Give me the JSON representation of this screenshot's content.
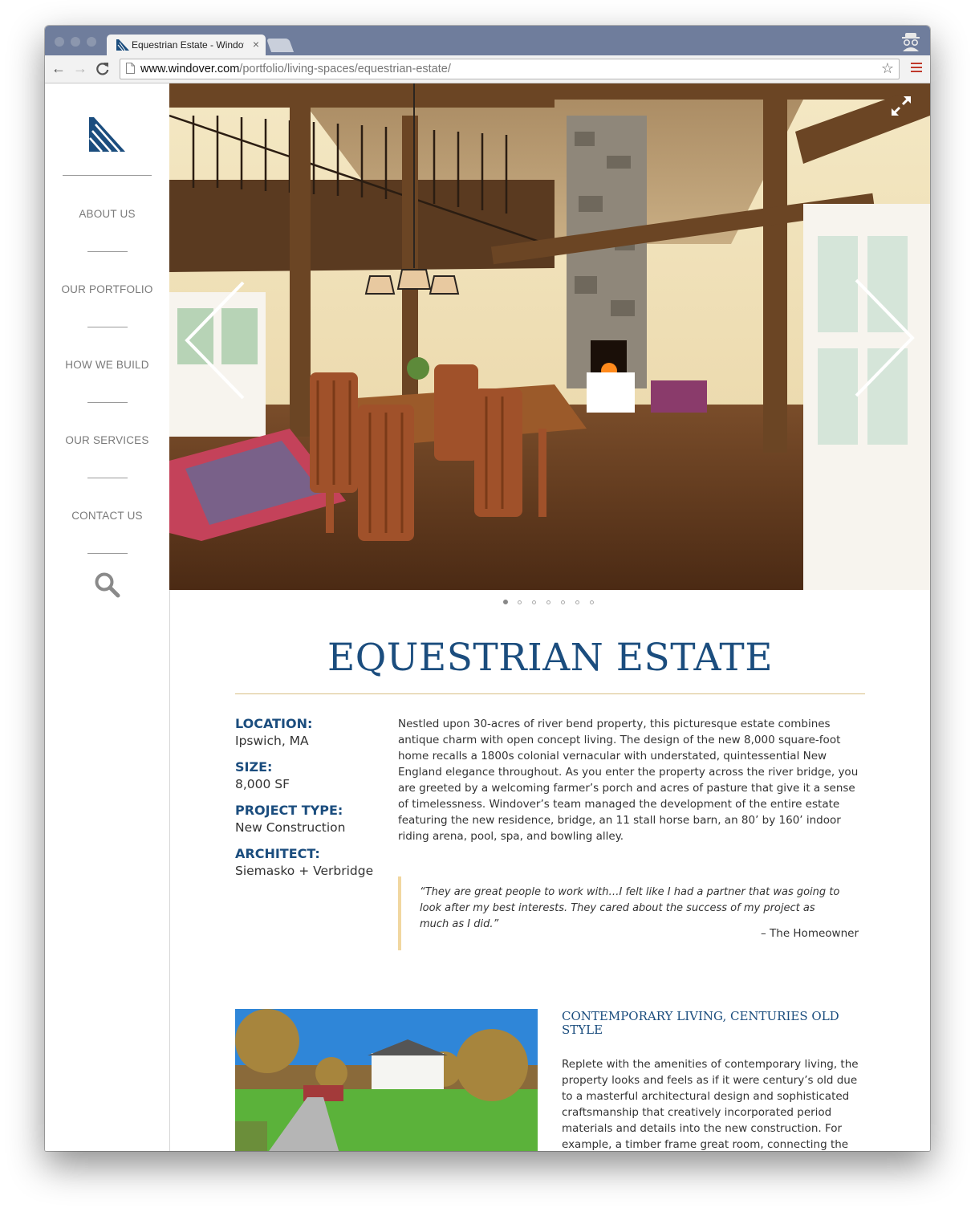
{
  "browser": {
    "tab_title": "Equestrian Estate - Windover",
    "tab_close": "×",
    "back_glyph": "←",
    "forward_glyph": "→",
    "reload_glyph": "C",
    "url_host": "www.windover.com",
    "url_path": "/portfolio/living-spaces/equestrian-estate/",
    "star_glyph": "☆",
    "accent_color": "#c0392b"
  },
  "sidebar": {
    "nav": [
      {
        "label": "ABOUT US"
      },
      {
        "label": "OUR PORTFOLIO"
      },
      {
        "label": "HOW WE BUILD"
      },
      {
        "label": "OUR SERVICES"
      },
      {
        "label": "CONTACT US"
      }
    ],
    "search_icon": "search-icon",
    "logo_color": "#1b4d7e"
  },
  "hero": {
    "slide_count": 7,
    "active_slide": 1
  },
  "project": {
    "title": "EQUESTRIAN ESTATE",
    "specs": [
      {
        "label": "LOCATION:",
        "value": "Ipswich, MA"
      },
      {
        "label": "SIZE:",
        "value": "8,000 SF"
      },
      {
        "label": "PROJECT TYPE:",
        "value": "New Construction"
      },
      {
        "label": "ARCHITECT:",
        "value": "Siemasko + Verbridge"
      }
    ],
    "description": "Nestled upon 30-acres of river bend property, this picturesque estate combines antique charm with open concept living. The design of the new 8,000 square-foot home recalls a 1800s colonial vernacular with understated, quintessential New England elegance throughout. As you enter the property across the river bridge, you are greeted by a welcoming farmer’s porch and acres of pasture that give it a sense of timelessness. Windover’s team managed the development of the entire estate featuring the new residence, bridge, an 11 stall horse barn, an 80’ by 160’ indoor riding arena, pool, spa, and bowling alley.",
    "quote": "“They are great people to work with…I felt like I had a partner that was going to look after my best interests. They cared about the success of my project as much as I did.”",
    "quote_attribution": "– The Homeowner",
    "section_heading": "CONTEMPORARY LIVING, CENTURIES OLD STYLE",
    "section_body": "Replete with the amenities of contemporary living, the property looks and feels as if it were century’s old due to a masterful architectural design and sophisticated craftsmanship that creatively incorporated period materials and details into the new construction. For example, a timber frame great room, connecting the",
    "brand_color": "#1b4d7e",
    "rule_color": "#d9bf84"
  }
}
